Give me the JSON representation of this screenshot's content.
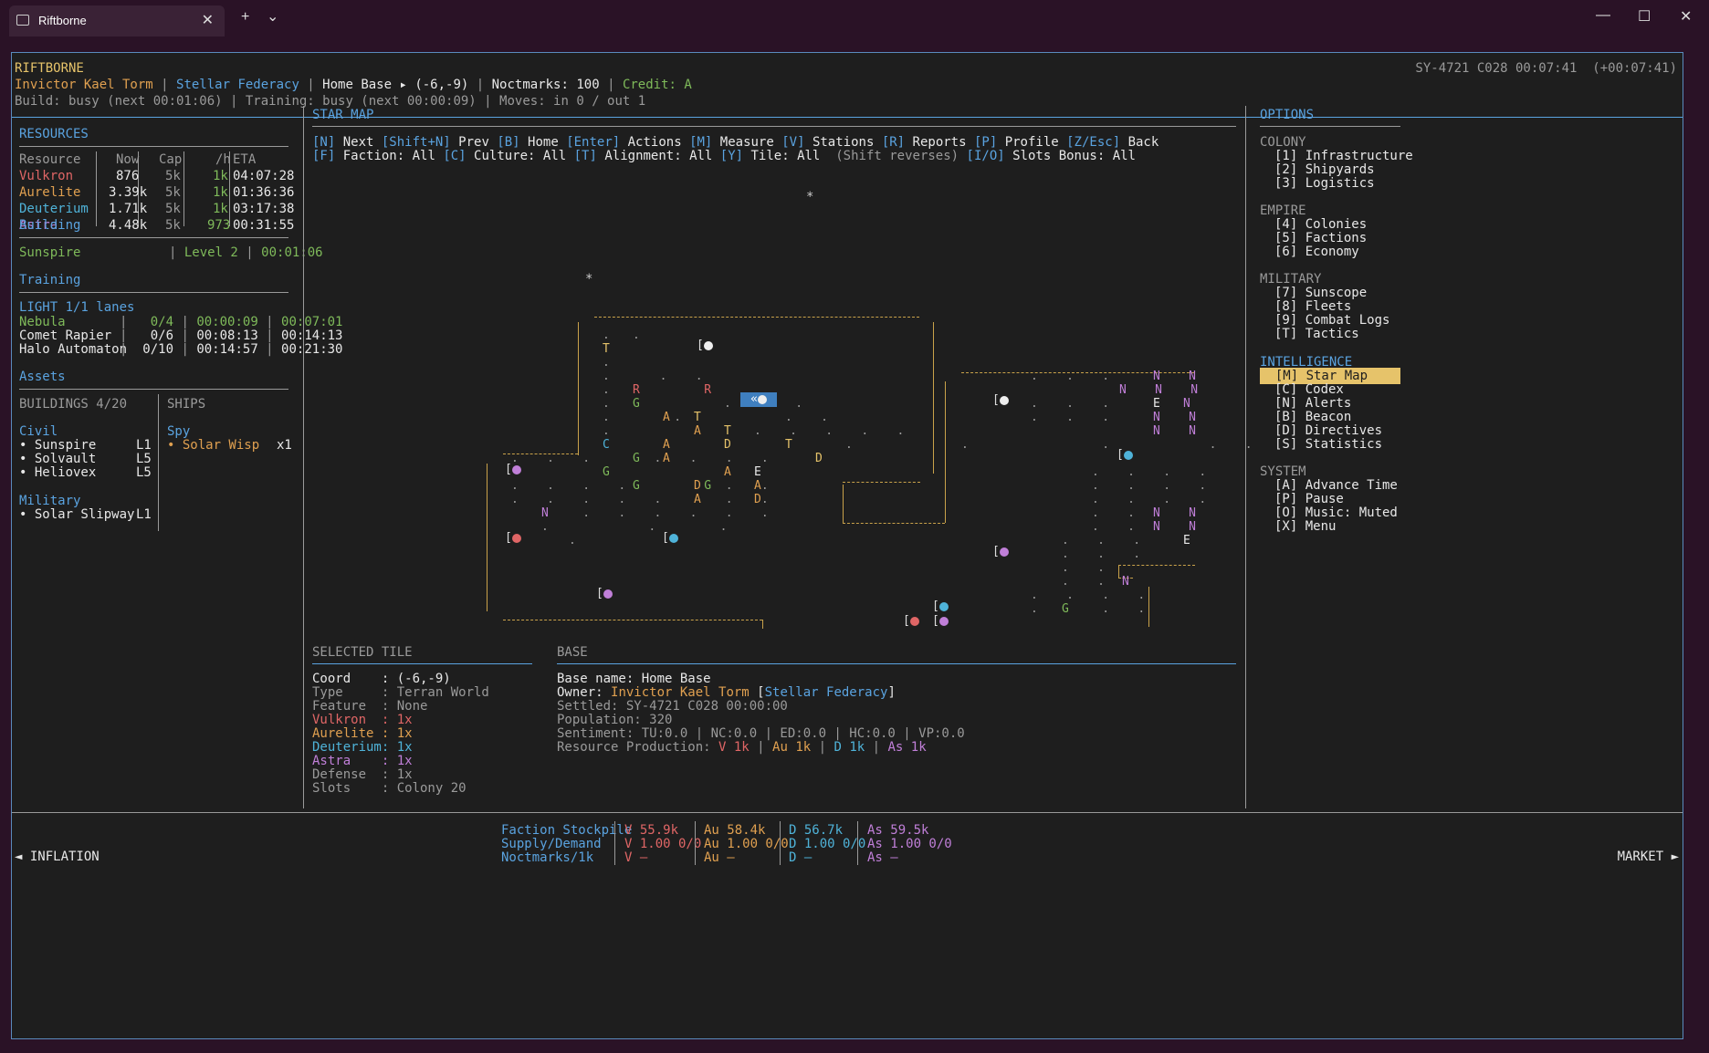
{
  "window": {
    "tab_title": "Riftborne",
    "new_tab": "+",
    "tab_menu": "⌄",
    "minimize": "—",
    "maximize": "☐",
    "close": "✕"
  },
  "header": {
    "app_name": "RIFTBORNE",
    "player": "Invictor Kael Torm",
    "faction": "Stellar Federacy",
    "base": "Home Base ▸ (-6,-9)",
    "noctmarks": "Noctmarks: 100",
    "credit": "Credit: A",
    "build": "Build: busy (next 00:01:06)",
    "training": "Training: busy (next 00:00:09)",
    "moves": "Moves: in 0 / out 1",
    "clock": "SY-4721 C028 00:07:41  (+00:07:41)"
  },
  "resources": {
    "title": "RESOURCES",
    "headers": [
      "Resource",
      "Now",
      "Cap",
      "/h",
      "ETA"
    ],
    "rows": [
      {
        "name": "Vulkron",
        "now": "876",
        "cap": "5k",
        "rate": "1k",
        "eta": "04:07:28",
        "color": "#e06666"
      },
      {
        "name": "Aurelite",
        "now": "3.39k",
        "cap": "5k",
        "rate": "1k",
        "eta": "01:36:36",
        "color": "#e0a050"
      },
      {
        "name": "Deuterium",
        "now": "1.71k",
        "cap": "5k",
        "rate": "1k",
        "eta": "03:17:38",
        "color": "#4fb3d9"
      },
      {
        "name": "Astra",
        "now": "4.48k",
        "cap": "5k",
        "rate": "973",
        "eta": "00:31:55",
        "color": "#c07fd8"
      }
    ]
  },
  "building": {
    "title": "Building",
    "name": "Sunspire",
    "level": "Level 2",
    "time": "00:01:06"
  },
  "training": {
    "title": "Training",
    "lanes": "LIGHT 1/1 lanes",
    "rows": [
      {
        "name": "Nebula",
        "count": "0/4",
        "next": "00:00:09",
        "total": "00:07:01"
      },
      {
        "name": "Comet Rapier",
        "count": "0/6",
        "next": "00:08:13",
        "total": "00:14:13"
      },
      {
        "name": "Halo Automaton",
        "count": "0/10",
        "next": "00:14:57",
        "total": "00:21:30"
      }
    ]
  },
  "assets": {
    "title": "Assets",
    "buildings_title": "BUILDINGS 4/20",
    "ships_title": "SHIPS",
    "civil_title": "Civil",
    "civil": [
      {
        "name": "• Sunspire",
        "level": "L1"
      },
      {
        "name": "• Solvault",
        "level": "L5"
      },
      {
        "name": "• Heliovex",
        "level": "L5"
      }
    ],
    "military_title": "Military",
    "military": [
      {
        "name": "• Solar Slipway",
        "level": "L1"
      }
    ],
    "spy_title": "Spy",
    "ships": [
      {
        "name": "• Solar Wisp",
        "count": "x1"
      }
    ]
  },
  "starmap": {
    "title": "STAR MAP",
    "help1": [
      {
        "key": "[N]",
        "label": " Next "
      },
      {
        "key": "[Shift+N]",
        "label": " Prev "
      },
      {
        "key": "[B]",
        "label": " Home "
      },
      {
        "key": "[Enter]",
        "label": " Actions "
      },
      {
        "key": "[M]",
        "label": " Measure "
      },
      {
        "key": "[V]",
        "label": " Stations "
      },
      {
        "key": "[R]",
        "label": " Reports "
      },
      {
        "key": "[P]",
        "label": " Profile "
      },
      {
        "key": "[Z/Esc]",
        "label": " Back"
      }
    ],
    "help2": [
      {
        "key": "[F]",
        "label": " Faction: All "
      },
      {
        "key": "[C]",
        "label": " Culture: All "
      },
      {
        "key": "[T]",
        "label": " Alignment: All "
      },
      {
        "key": "[Y]",
        "label": " Tile: All  "
      },
      {
        "key": "",
        "label": "(Shift reverses) "
      },
      {
        "key": "[I/O]",
        "label": " Slots Bonus: All"
      }
    ],
    "cursor": "«"
  },
  "selected_tile": {
    "title": "SELECTED TILE",
    "rows": [
      {
        "label": "Coord    ",
        "value": ": (-6,-9)",
        "color": "#e8e8e8"
      },
      {
        "label": "Type     ",
        "value": ": Terran World",
        "color": "#9a9a9a"
      },
      {
        "label": "Feature  ",
        "value": ": None",
        "color": "#9a9a9a"
      },
      {
        "label": "Vulkron  ",
        "value": ": 1x",
        "color": "#e06666"
      },
      {
        "label": "Aurelite ",
        "value": ": 1x",
        "color": "#e0a050"
      },
      {
        "label": "Deuterium",
        "value": ": 1x",
        "color": "#4fb3d9"
      },
      {
        "label": "Astra    ",
        "value": ": 1x",
        "color": "#c07fd8"
      },
      {
        "label": "Defense  ",
        "value": ": 1x",
        "color": "#9a9a9a"
      },
      {
        "label": "Slots    ",
        "value": ": Colony 20",
        "color": "#9a9a9a"
      }
    ]
  },
  "base": {
    "title": "BASE",
    "name": "Base name: Home Base",
    "owner_label": "Owner: ",
    "owner_name": "Invictor Kael Torm",
    "owner_faction": "Stellar Federacy",
    "settled": "Settled: SY-4721 C028 00:00:00",
    "population": "Population: 320",
    "sentiment": "Sentiment: TU:0.0 | NC:0.0 | ED:0.0 | HC:0.0 | VP:0.0",
    "production_label": "Resource Production: ",
    "production": [
      {
        "text": "V 1k",
        "color": "#e06666"
      },
      {
        "text": "Au 1k",
        "color": "#e0a050"
      },
      {
        "text": "D 1k",
        "color": "#4fb3d9"
      },
      {
        "text": "As 1k",
        "color": "#c07fd8"
      }
    ]
  },
  "options": {
    "title": "OPTIONS",
    "groups": [
      {
        "name": "COLONY",
        "items": [
          "[1] Infrastructure",
          "[2] Shipyards",
          "[3] Logistics"
        ]
      },
      {
        "name": "EMPIRE",
        "items": [
          "[4] Colonies",
          "[5] Factions",
          "[6] Economy"
        ]
      },
      {
        "name": "MILITARY",
        "items": [
          "[7] Sunscope",
          "[8] Fleets",
          "[9] Combat Logs",
          "[T] Tactics"
        ]
      },
      {
        "name": "INTELLIGENCE",
        "items": [
          "[M] Star Map",
          "[C] Codex",
          "[N] Alerts",
          "[B] Beacon",
          "[D] Directives",
          "[S] Statistics"
        ]
      },
      {
        "name": "SYSTEM",
        "items": [
          "[A] Advance Time",
          "[P] Pause",
          "[O] Music: Muted",
          "[X] Menu"
        ]
      }
    ],
    "selected": "[M] Star Map"
  },
  "footer": {
    "left": "◄ INFLATION",
    "right": "MARKET ►",
    "labels": [
      "Faction Stockpile",
      "Supply/Demand",
      "Noctmarks/1k"
    ],
    "columns": [
      {
        "color": "#e06666",
        "lines": [
          "V 55.9k",
          "V 1.00 0/0",
          "V –"
        ]
      },
      {
        "color": "#e0a050",
        "lines": [
          "Au 58.4k",
          "Au 1.00 0/0",
          "Au –"
        ]
      },
      {
        "color": "#4fb3d9",
        "lines": [
          "D 56.7k",
          "D 1.00 0/0",
          "D –"
        ]
      },
      {
        "color": "#c07fd8",
        "lines": [
          "As 59.5k",
          "As 1.00 0/0",
          "As –"
        ]
      }
    ]
  }
}
